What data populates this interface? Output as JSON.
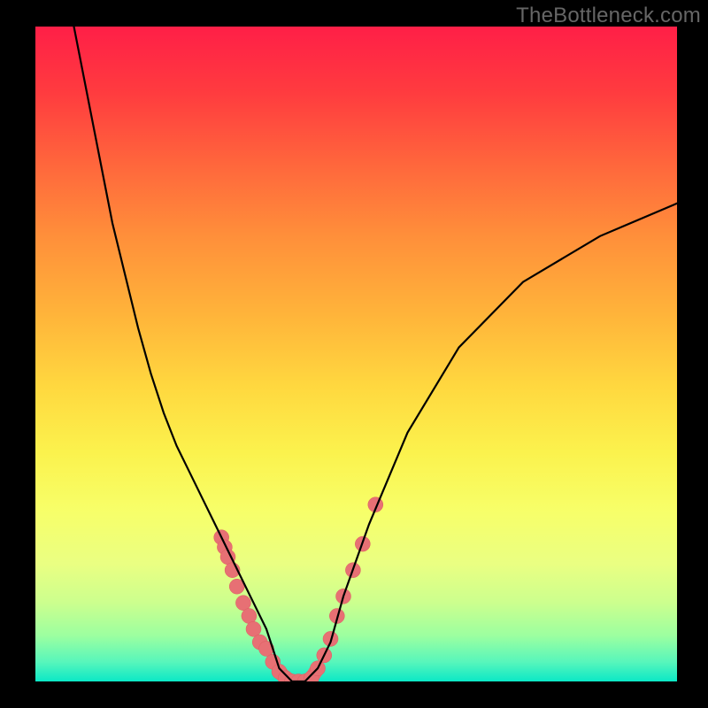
{
  "watermark": "TheBottleneck.com",
  "colors": {
    "background": "#000000",
    "curve": "#000000",
    "bead_fill": "#e77074",
    "bead_stroke": "#de5b60",
    "gradient_top": "#ff1f47",
    "gradient_bottom": "#0be8c6"
  },
  "chart_data": {
    "type": "line",
    "title": "",
    "xlabel": "",
    "ylabel": "",
    "xlim": [
      0,
      100
    ],
    "ylim": [
      0,
      100
    ],
    "grid": false,
    "legend": false,
    "series": [
      {
        "name": "curve",
        "x": [
          6,
          8,
          10,
          12,
          14,
          16,
          18,
          20,
          22,
          24,
          26,
          28,
          30,
          32,
          34,
          36,
          37,
          38,
          40,
          42,
          44,
          46,
          48,
          52,
          58,
          66,
          76,
          88,
          100
        ],
        "y": [
          100,
          90,
          80,
          70,
          62,
          54,
          47,
          41,
          36,
          32,
          28,
          24,
          20,
          16,
          12,
          8,
          5,
          2,
          0,
          0,
          2,
          6,
          13,
          24,
          38,
          51,
          61,
          68,
          73
        ]
      }
    ],
    "bead_points": [
      {
        "x": 29,
        "y": 22
      },
      {
        "x": 29.5,
        "y": 20.5
      },
      {
        "x": 30,
        "y": 19
      },
      {
        "x": 30.7,
        "y": 17
      },
      {
        "x": 31.4,
        "y": 14.5
      },
      {
        "x": 32.4,
        "y": 12
      },
      {
        "x": 33.3,
        "y": 10
      },
      {
        "x": 34,
        "y": 8
      },
      {
        "x": 35,
        "y": 6
      },
      {
        "x": 36,
        "y": 5
      },
      {
        "x": 37,
        "y": 3
      },
      {
        "x": 38,
        "y": 1.5
      },
      {
        "x": 39,
        "y": 0.5
      },
      {
        "x": 40,
        "y": 0
      },
      {
        "x": 41,
        "y": 0
      },
      {
        "x": 42,
        "y": 0
      },
      {
        "x": 43,
        "y": 0.5
      },
      {
        "x": 44,
        "y": 2
      },
      {
        "x": 45,
        "y": 4
      },
      {
        "x": 46,
        "y": 6.5
      },
      {
        "x": 47,
        "y": 10
      },
      {
        "x": 48,
        "y": 13
      },
      {
        "x": 49.5,
        "y": 17
      },
      {
        "x": 51,
        "y": 21
      },
      {
        "x": 53,
        "y": 27
      }
    ]
  }
}
